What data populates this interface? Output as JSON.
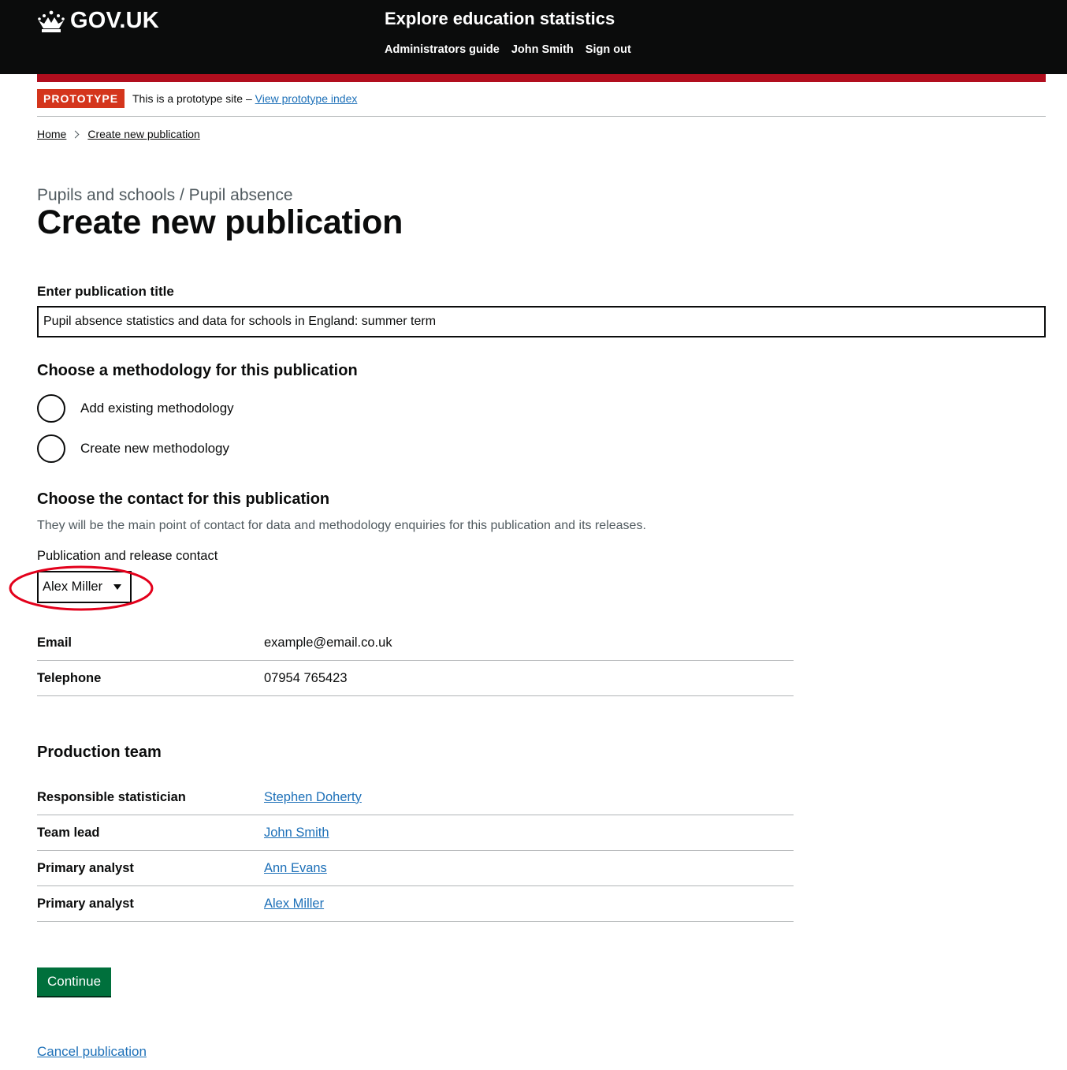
{
  "header": {
    "logo_text": "GOV.UK",
    "service_name": "Explore education statistics",
    "nav": [
      "Administrators guide",
      "John Smith",
      "Sign out"
    ]
  },
  "phase_banner": {
    "tag": "PROTOTYPE",
    "text": "This is a prototype site –",
    "link": "View prototype index"
  },
  "breadcrumb": [
    "Home",
    "Create new publication"
  ],
  "caption": "Pupils and schools / Pupil absence",
  "title": "Create new publication",
  "form": {
    "title_label": "Enter publication title",
    "title_value": "Pupil absence statistics and data for schools in England: summer term",
    "methodology_heading": "Choose a methodology for this publication",
    "methodology_options": [
      "Add existing methodology",
      "Create new methodology"
    ],
    "contact_heading": "Choose the contact for this publication",
    "contact_hint": "They will be the main point of contact for data and methodology enquiries for this publication and its releases.",
    "contact_select_label": "Publication and release contact",
    "contact_selected": "Alex Miller"
  },
  "contact_details": [
    {
      "key": "Email",
      "value": "example@email.co.uk"
    },
    {
      "key": "Telephone",
      "value": "07954 765423"
    }
  ],
  "production_team": {
    "heading": "Production team",
    "rows": [
      {
        "key": "Responsible statistician",
        "value": "Stephen Doherty"
      },
      {
        "key": "Team lead",
        "value": "John Smith"
      },
      {
        "key": "Primary analyst",
        "value": "Ann Evans"
      },
      {
        "key": "Primary analyst",
        "value": "Alex Miller"
      }
    ]
  },
  "actions": {
    "continue": "Continue",
    "cancel": "Cancel publication"
  },
  "colors": {
    "header_bg": "#0b0c0c",
    "red_bar": "#b10e1e",
    "phase_tag": "#d4351c",
    "link": "#1d70b8",
    "button": "#00703c",
    "annotation": "#e3001b"
  }
}
